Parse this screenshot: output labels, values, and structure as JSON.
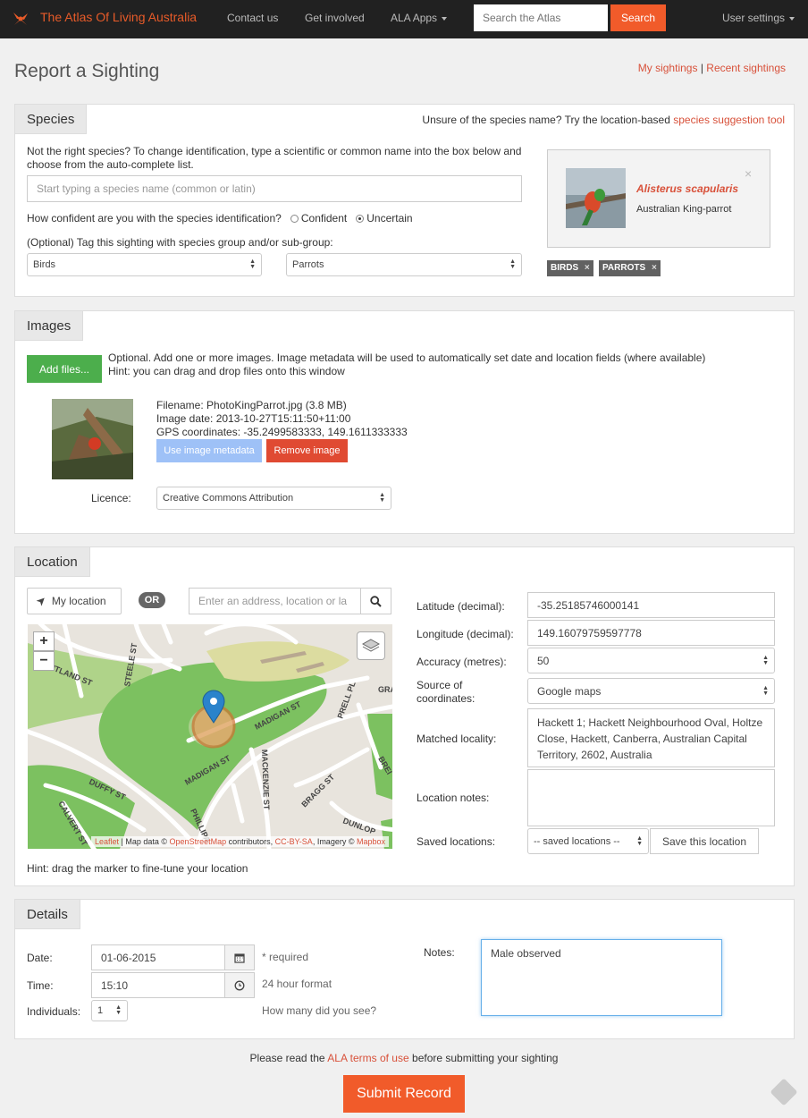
{
  "nav": {
    "brand": "The Atlas Of Living Australia",
    "contact": "Contact us",
    "involved": "Get involved",
    "apps": "ALA Apps",
    "search_placeholder": "Search the Atlas",
    "search_btn": "Search",
    "user_settings": "User settings"
  },
  "page": {
    "title": "Report a Sighting",
    "my_sightings": "My sightings",
    "separator": "|",
    "recent_sightings": "Recent sightings"
  },
  "species": {
    "tab": "Species",
    "hint_prefix": "Unsure of the species name? Try the location-based",
    "hint_link": "species suggestion tool",
    "change_text": "Not the right species? To change identification, type a scientific or common name into the box below and choose from the auto-complete list.",
    "search_placeholder": "Start typing a species name (common or latin)",
    "confidence_q": "How confident are you with the species identification?",
    "confident": "Confident",
    "uncertain": "Uncertain",
    "tag_label": "(Optional) Tag this sighting with species group and/or sub-group:",
    "group": "Birds",
    "subgroup": "Parrots",
    "sci_name": "Alisterus scapularis",
    "common_name": "Australian King-parrot",
    "tags": [
      "BIRDS",
      "PARROTS"
    ]
  },
  "images": {
    "tab": "Images",
    "add_btn": "Add files...",
    "hint1": "Optional. Add one or more images. Image metadata will be used to automatically set date and location fields (where available)",
    "hint2": "Hint: you can drag and drop files onto this window",
    "filename": "Filename: PhotoKingParrot.jpg (3.8 MB)",
    "image_date": "Image date: 2013-10-27T15:11:50+11:00",
    "gps": "GPS coordinates: -35.2499583333, 149.1611333333",
    "use_meta": "Use image metadata",
    "remove": "Remove image",
    "licence_label": "Licence:",
    "licence": "Creative Commons Attribution"
  },
  "location": {
    "tab": "Location",
    "my_location": "My location",
    "or": "OR",
    "address_placeholder": "Enter an address, location or la",
    "lat_label": "Latitude (decimal):",
    "lat": "-35.25185746000141",
    "lng_label": "Longitude (decimal):",
    "lng": "149.16079759597778",
    "acc_label": "Accuracy (metres):",
    "acc": "50",
    "source_label": "Source of coordinates:",
    "source": "Google maps",
    "matched_label": "Matched locality:",
    "matched": "Hackett 1; Hackett Neighbourhood Oval, Holtze Close, Hackett, Canberra, Australian Capital Territory, 2602, Australia",
    "notes_label": "Location notes:",
    "saved_label": "Saved locations:",
    "saved": "-- saved locations --",
    "save_btn": "Save this location",
    "hint": "Hint: drag the marker to fine-tune your location",
    "map": {
      "streets": [
        "MAITLAND ST",
        "STEELE ST",
        "MADIGAN ST",
        "MADIGAN ST",
        "MACKENZIE ST",
        "PRELL PL",
        "BRAGG ST",
        "DUFFY ST",
        "CALVERT ST",
        "DUNLOP",
        "PHILLIPA",
        "GRA",
        "BREI"
      ],
      "attribution": [
        {
          "text": "Leaflet",
          "link": true
        },
        {
          "text": " | Map data © ",
          "link": false
        },
        {
          "text": "OpenStreetMap",
          "link": true
        },
        {
          "text": " contributors, ",
          "link": false
        },
        {
          "text": "CC-BY-SA",
          "link": true
        },
        {
          "text": ", Imagery © ",
          "link": false
        },
        {
          "text": "Mapbox",
          "link": true
        }
      ]
    }
  },
  "details": {
    "tab": "Details",
    "date_label": "Date:",
    "date": "01-06-2015",
    "required": "* required",
    "time_label": "Time:",
    "time": "15:10",
    "time_format": "24 hour format",
    "individuals_label": "Individuals:",
    "individuals": "1",
    "howmany": "How many did you see?",
    "notes_label": "Notes:",
    "notes": "Male observed"
  },
  "footer": {
    "terms_prefix": "Please read the",
    "terms_link": "ALA terms of use",
    "terms_suffix": "before submitting your sighting",
    "submit": "Submit Record"
  },
  "colors": {
    "accent": "#f15b2a",
    "link": "#d8513a",
    "green": "#4cae4c",
    "blue_btn": "#9ec1f7",
    "red_btn": "#e04a32"
  }
}
